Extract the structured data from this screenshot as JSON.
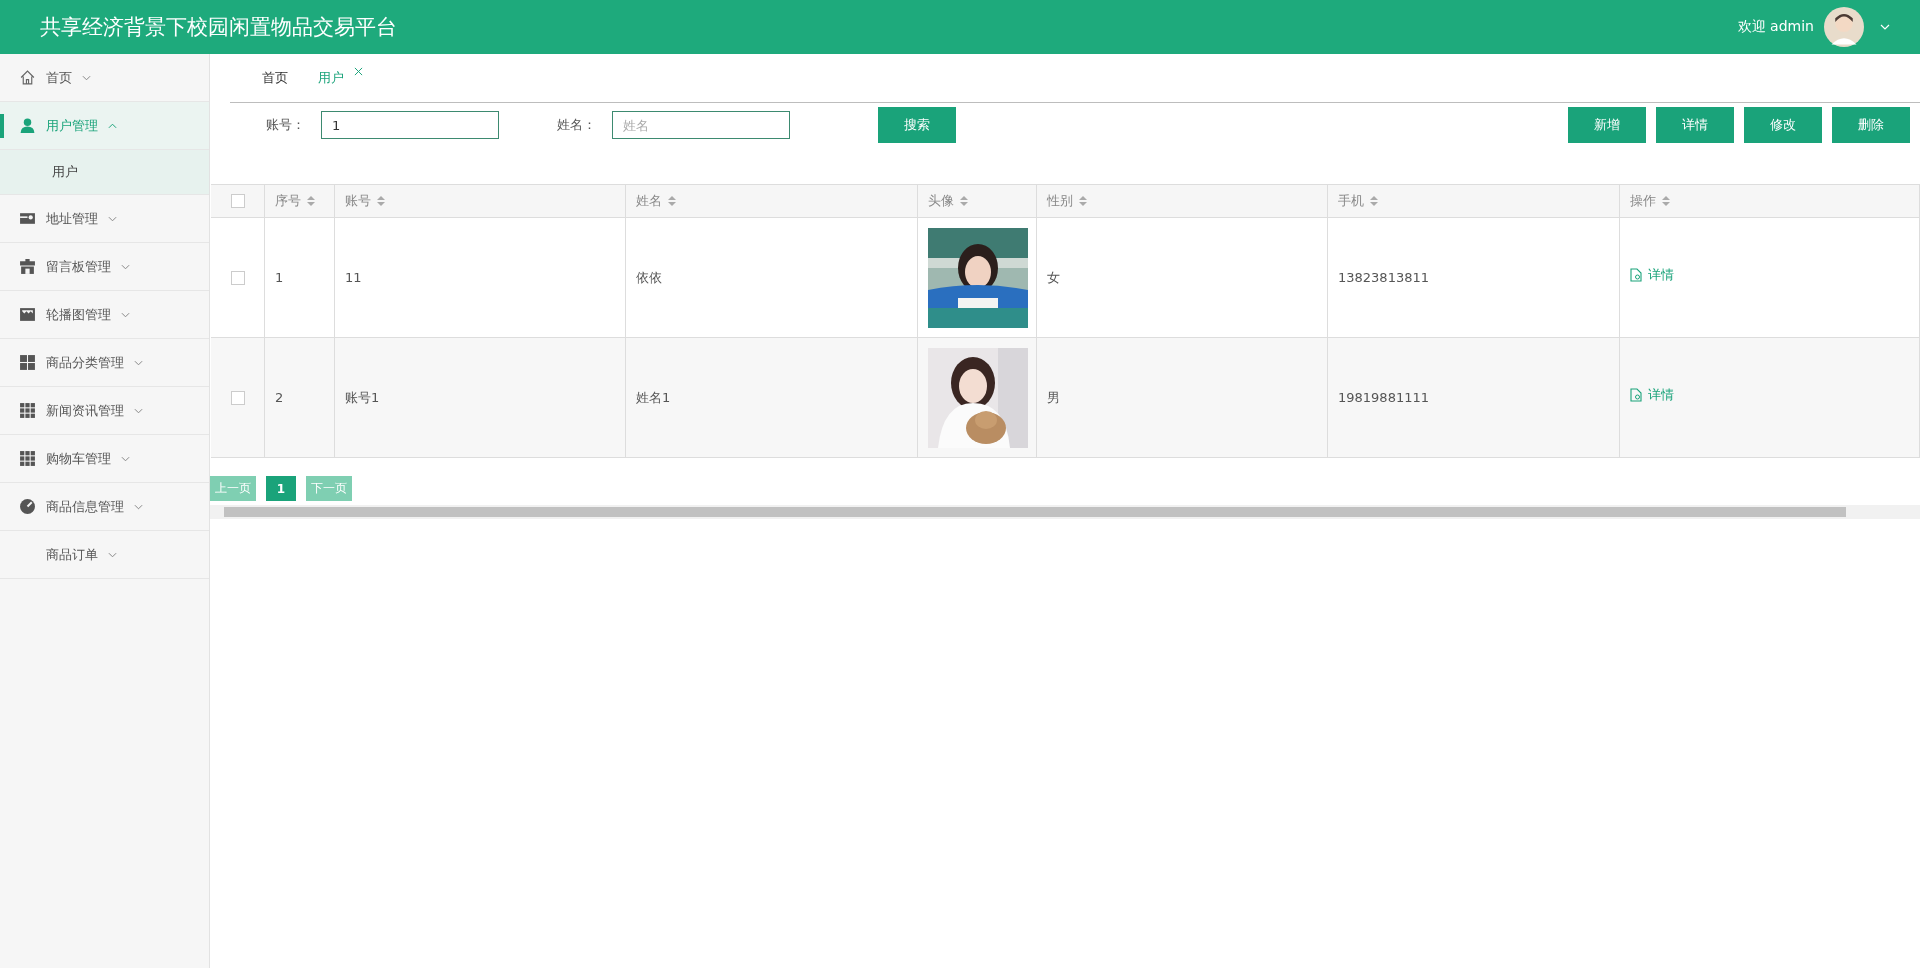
{
  "header": {
    "title": "共享经济背景下校园闲置物品交易平台",
    "welcome": "欢迎 admin"
  },
  "sidebar": {
    "items": [
      {
        "label": "首页",
        "expanded": false,
        "selected": false
      },
      {
        "label": "用户管理",
        "expanded": true,
        "selected": true,
        "children": [
          {
            "label": "用户",
            "selected": true
          }
        ]
      },
      {
        "label": "地址管理",
        "expanded": false,
        "selected": false
      },
      {
        "label": "留言板管理",
        "expanded": false,
        "selected": false
      },
      {
        "label": "轮播图管理",
        "expanded": false,
        "selected": false
      },
      {
        "label": "商品分类管理",
        "expanded": false,
        "selected": false
      },
      {
        "label": "新闻资讯管理",
        "expanded": false,
        "selected": false
      },
      {
        "label": "购物车管理",
        "expanded": false,
        "selected": false
      },
      {
        "label": "商品信息管理",
        "expanded": false,
        "selected": false
      },
      {
        "label": "商品订单",
        "expanded": false,
        "selected": false
      }
    ]
  },
  "tabs": [
    {
      "label": "首页",
      "selected": false,
      "closable": false
    },
    {
      "label": "用户",
      "selected": true,
      "closable": true
    }
  ],
  "search": {
    "fields": [
      {
        "label": "账号：",
        "value": "1"
      },
      {
        "label": "姓名：",
        "placeholder": "姓名"
      }
    ],
    "button": "搜索"
  },
  "actions": [
    "新增",
    "详情",
    "修改",
    "删除"
  ],
  "table": {
    "select_all": {
      "checked": false
    },
    "columns": [
      {
        "label": "序号"
      },
      {
        "label": "账号"
      },
      {
        "label": "姓名"
      },
      {
        "label": "头像"
      },
      {
        "label": "性别"
      },
      {
        "label": "手机"
      },
      {
        "label": "操作"
      }
    ],
    "rows": [
      {
        "checked": false,
        "index": "1",
        "account": "11",
        "name": "依依",
        "gender": "女",
        "phone": "13823813811",
        "action": "详情"
      },
      {
        "checked": false,
        "index": "2",
        "account": "账号1",
        "name": "姓名1",
        "gender": "男",
        "phone": "19819881111",
        "action": "详情"
      }
    ]
  },
  "pagination": {
    "prev": "上一页",
    "pages": [
      {
        "label": "1",
        "selected": true
      }
    ],
    "next": "下一页"
  }
}
